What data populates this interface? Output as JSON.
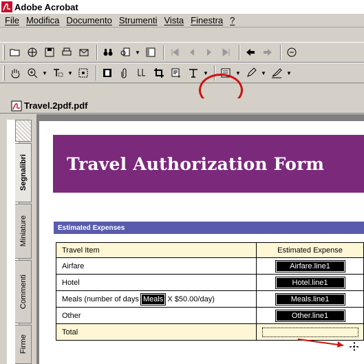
{
  "window": {
    "title": "Adobe Acrobat"
  },
  "menu": [
    "File",
    "Modifica",
    "Documento",
    "Strumenti",
    "Vista",
    "Finestra",
    "?"
  ],
  "document": {
    "name": "Travel.2pdf.pdf"
  },
  "nav_tabs": [
    "Segnalibri",
    "Miniature",
    "Commenti",
    "Firme"
  ],
  "form": {
    "banner_title": "Travel Authorization Form",
    "section_title": "Estimated Expenses",
    "header": {
      "item": "Travel Item",
      "amount": "Estimated Expense"
    },
    "rows": [
      {
        "item": "Airfare",
        "field": "Airfare.line1"
      },
      {
        "item": "Hotel",
        "field": "Hotel.line1"
      },
      {
        "item_prefix": "Meals (number of days",
        "days_field": "Meals",
        "item_suffix": "X $50.00/day)",
        "field": "Meals.line1"
      },
      {
        "item": "Other",
        "field": "Other.line1"
      }
    ],
    "total_label": "Total"
  },
  "colors": {
    "banner": "#7b2a7b",
    "section_bar": "#595cae",
    "highlight": "#d01010"
  }
}
